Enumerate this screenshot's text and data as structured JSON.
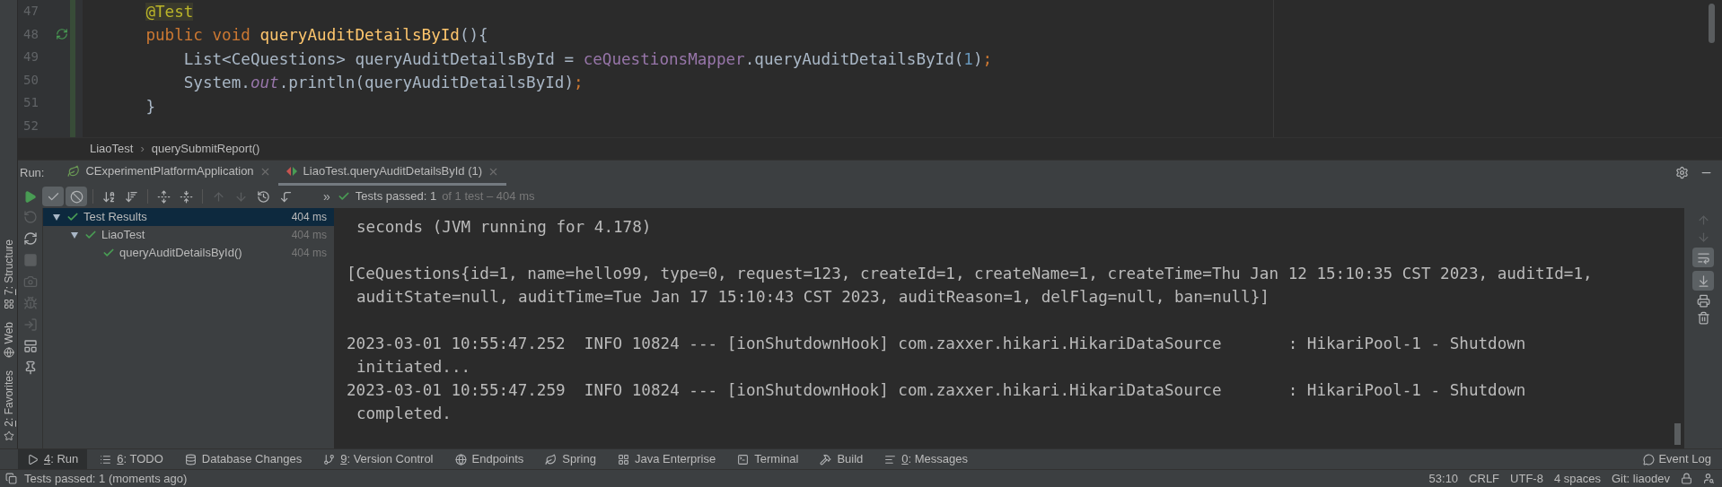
{
  "editor": {
    "lines": [
      {
        "number": "47",
        "tokens": [
          {
            "kind": "annotation",
            "text": "    @Test"
          }
        ]
      },
      {
        "number": "48",
        "run_gutter": true,
        "tokens": [
          {
            "kind": "keyword",
            "text": "    public void "
          },
          {
            "kind": "method",
            "text": "queryAuditDetailsById"
          },
          {
            "kind": "plain",
            "text": "(){"
          }
        ]
      },
      {
        "number": "49",
        "tokens": [
          {
            "kind": "plain",
            "text": "        List<CeQuestions> queryAuditDetailsById = "
          },
          {
            "kind": "field",
            "text": "ceQuestionsMapper"
          },
          {
            "kind": "plain",
            "text": ".queryAuditDetailsById("
          },
          {
            "kind": "number",
            "text": "1"
          },
          {
            "kind": "plain",
            "text": ")"
          },
          {
            "kind": "keyword",
            "text": ";"
          }
        ]
      },
      {
        "number": "50",
        "tokens": [
          {
            "kind": "plain",
            "text": "        System."
          },
          {
            "kind": "static",
            "text": "out"
          },
          {
            "kind": "plain",
            "text": ".println(queryAuditDetailsById)"
          },
          {
            "kind": "keyword",
            "text": ";"
          }
        ]
      },
      {
        "number": "51",
        "tokens": [
          {
            "kind": "plain",
            "text": "    }"
          }
        ]
      },
      {
        "number": "52"
      }
    ]
  },
  "breadcrumbs": [
    "LiaoTest",
    "querySubmitReport()"
  ],
  "breadcrumb_separator": "›",
  "run": {
    "label": "Run:",
    "tabs": [
      {
        "label": "CExperimentPlatformApplication",
        "kind": "app",
        "selected": false
      },
      {
        "label": "LiaoTest.queryAuditDetailsById (1)",
        "kind": "test",
        "selected": true
      }
    ],
    "toolbar": {
      "show_passed": {
        "selected": true
      },
      "show_ignored": {
        "selected": true
      },
      "prev_failed": {
        "disabled": true
      },
      "next_failed": {
        "disabled": true
      },
      "more": "»",
      "status": "Tests passed: 1",
      "status_detail": "of 1 test – 404 ms"
    },
    "side_toolbar": {
      "rerun_failed": {
        "disabled": true
      },
      "stop": {
        "disabled": true
      }
    },
    "tree": [
      {
        "label": "Test Results",
        "time": "404 ms",
        "selected": true,
        "expanded": true,
        "children": [
          {
            "label": "LiaoTest",
            "time": "404 ms",
            "selected": false,
            "expanded": true,
            "children": [
              {
                "label": "queryAuditDetailsById()",
                "time": "404 ms",
                "selected": false
              }
            ]
          }
        ]
      }
    ],
    "console": [
      {
        "text": "seconds (JVM running for 4.178)",
        "continued": true
      },
      {
        "text": "[CeQuestions{id=1, name=hello99, type=0, request=123, createId=1, createName=1, createTime=Thu Jan 12 15:10:35 CST 2023, auditId=1,",
        "continued": false,
        "blank_before": true
      },
      {
        "text": "auditState=null, auditTime=Tue Jan 17 15:10:43 CST 2023, auditReason=1, delFlag=null, ban=null}]",
        "continued": true
      },
      {
        "text": "2023-03-01 10:55:47.252  INFO 10824 --- [ionShutdownHook] com.zaxxer.hikari.HikariDataSource       : HikariPool-1 - Shutdown",
        "continued": false,
        "blank_before": true
      },
      {
        "text": "initiated...",
        "continued": true
      },
      {
        "text": "2023-03-01 10:55:47.259  INFO 10824 --- [ionShutdownHook] com.zaxxer.hikari.HikariDataSource       : HikariPool-1 - Shutdown",
        "continued": false
      },
      {
        "text": "completed.",
        "continued": true
      }
    ],
    "console_toolbar": {
      "up": {
        "disabled": true
      },
      "down": {
        "disabled": true
      },
      "soft_wrap": {
        "selected": true
      },
      "scroll_to_end": {
        "selected": true
      }
    }
  },
  "side_labels": [
    {
      "mnemonic": "7",
      "label": ": Structure"
    },
    {
      "label": "Web"
    },
    {
      "mnemonic": "2",
      "label": ": Favorites"
    }
  ],
  "tool_tabs": [
    {
      "kind": "run",
      "mnemonic": "4",
      "label": ": Run",
      "selected": true
    },
    {
      "kind": "todo",
      "mnemonic": "6",
      "label": ": TODO",
      "selected": false
    },
    {
      "kind": "database",
      "label": "Database Changes",
      "selected": false
    },
    {
      "kind": "vcs",
      "mnemonic": "9",
      "label": ": Version Control",
      "selected": false
    },
    {
      "kind": "endpoints",
      "label": "Endpoints",
      "selected": false
    },
    {
      "kind": "spring",
      "label": "Spring",
      "selected": false
    },
    {
      "kind": "javaee",
      "label": "Java Enterprise",
      "selected": false
    },
    {
      "kind": "terminal",
      "label": "Terminal",
      "selected": false
    },
    {
      "kind": "build",
      "label": "Build",
      "selected": false
    },
    {
      "kind": "messages",
      "mnemonic": "0",
      "label": ": Messages",
      "selected": false
    }
  ],
  "event_log": "Event Log",
  "status_bar": {
    "message": "Tests passed: 1 (moments ago)",
    "items": [
      "53:10",
      "CRLF",
      "UTF-8",
      "4 spaces",
      "Git: liaodev"
    ]
  }
}
